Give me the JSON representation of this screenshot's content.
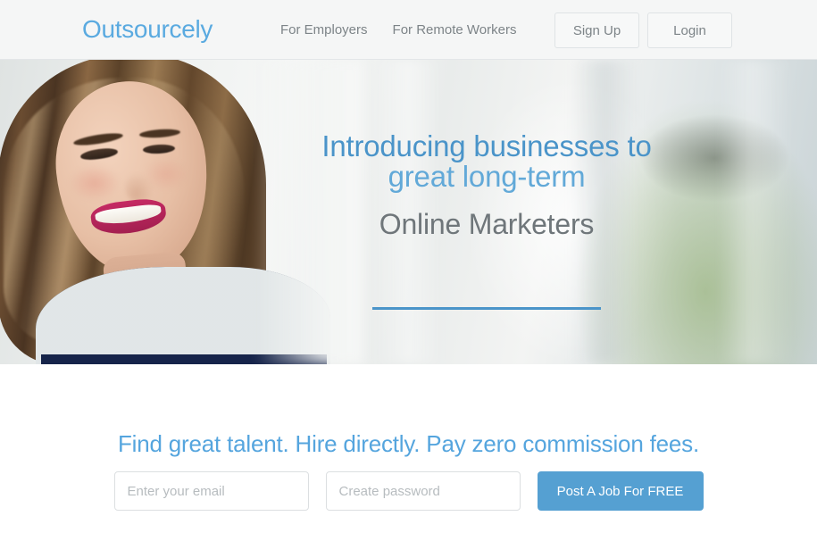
{
  "header": {
    "logo": "Outsourcely",
    "logo_color": "#5aaae0",
    "nav": [
      {
        "label": "For Employers"
      },
      {
        "label": "For Remote Workers"
      }
    ],
    "buttons": [
      {
        "label": "Sign Up"
      },
      {
        "label": "Login"
      }
    ]
  },
  "hero": {
    "title_line1": "Introducing businesses to",
    "title_line2": "great long-term",
    "subtitle": "Online Marketers",
    "title_color": "#4a94c9",
    "subtitle_color": "#6f767a",
    "rule_color": "#4a94c9",
    "image_alt": "smiling-woman-in-office"
  },
  "cta": {
    "heading": "Find great talent. Hire directly. Pay zero commission fees.",
    "heading_color": "#55a5de",
    "email": {
      "value": "",
      "placeholder": "Enter your email"
    },
    "password": {
      "value": "",
      "placeholder": "Create password"
    },
    "button_label": "Post A Job For FREE",
    "button_color": "#55a0d2"
  }
}
